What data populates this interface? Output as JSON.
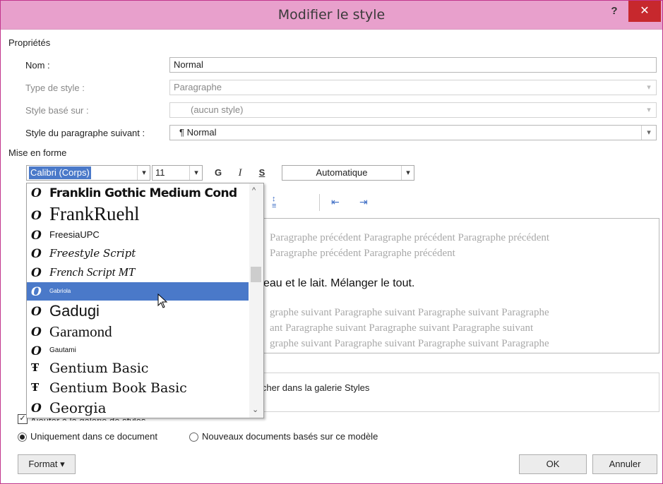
{
  "window": {
    "title": "Modifier le style",
    "help": "?",
    "close": "✕"
  },
  "properties": {
    "section_label": "Propriétés",
    "name_label": "Nom :",
    "name_value": "Normal",
    "type_label": "Type de style :",
    "type_value": "Paragraphe",
    "based_label": "Style basé sur :",
    "based_value": "(aucun style)",
    "next_label": "Style du paragraphe suivant :",
    "next_value": "¶  Normal"
  },
  "formatting": {
    "section_label": "Mise en forme",
    "font_value": "Calibri (Corps)",
    "size_value": "11",
    "bold": "G",
    "italic": "I",
    "underline": "S",
    "color_value": "Automatique"
  },
  "font_list": {
    "items": [
      {
        "name": "Franklin Gothic Medium Cond",
        "icon": "O"
      },
      {
        "name": "FrankRuehl",
        "icon": "O"
      },
      {
        "name": "FreesiaUPC",
        "icon": "O"
      },
      {
        "name": "Freestyle Script",
        "icon": "O"
      },
      {
        "name": "French Script MT",
        "icon": "O"
      },
      {
        "name": "Gabriola",
        "icon": "O"
      },
      {
        "name": "Gadugi",
        "icon": "O"
      },
      {
        "name": "Garamond",
        "icon": "O"
      },
      {
        "name": "Gautami",
        "icon": "O"
      },
      {
        "name": "Gentium Basic",
        "icon": "Ŧ"
      },
      {
        "name": "Gentium Book Basic",
        "icon": "Ŧ"
      },
      {
        "name": "Georgia",
        "icon": "O"
      }
    ],
    "selected": "Gabriola"
  },
  "preview": {
    "prev1": "Paragraphe précédent Paragraphe précédent Paragraphe précédent",
    "prev2": "Paragraphe précédent Paragraphe précédent",
    "sample": "eau et le lait. Mélanger le tout.",
    "next1": "graphe suivant Paragraphe suivant Paragraphe suivant Paragraphe",
    "next2": "ant Paragraphe suivant Paragraphe suivant Paragraphe suivant",
    "next3": "graphe suivant Paragraphe suivant Paragraphe suivant Paragraphe"
  },
  "options": {
    "gallery_checkbox_label": "fficher dans la galerie Styles",
    "add_gallery_label": "Ajouter à la galerie de styles",
    "radio_doc_label": "Uniquement dans ce document",
    "radio_template_label": "Nouveaux documents basés sur ce modèle"
  },
  "buttons": {
    "format": "Format ▾",
    "ok": "OK",
    "cancel": "Annuler"
  }
}
